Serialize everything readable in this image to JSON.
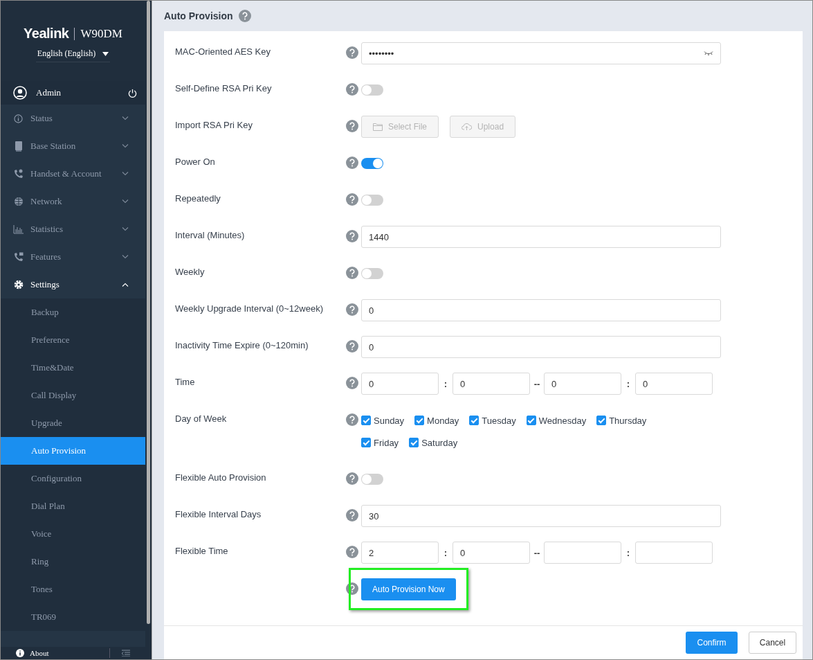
{
  "sidebar": {
    "logo": "Yealink",
    "model": "W90DM",
    "language": "English (English)",
    "user": "Admin",
    "menu": [
      {
        "label": "Status",
        "expanded": false
      },
      {
        "label": "Base Station",
        "expanded": false
      },
      {
        "label": "Handset & Account",
        "expanded": false
      },
      {
        "label": "Network",
        "expanded": false
      },
      {
        "label": "Statistics",
        "expanded": false
      },
      {
        "label": "Features",
        "expanded": false
      },
      {
        "label": "Settings",
        "expanded": true,
        "children": [
          {
            "label": "Backup",
            "selected": false
          },
          {
            "label": "Preference",
            "selected": false
          },
          {
            "label": "Time&Date",
            "selected": false
          },
          {
            "label": "Call Display",
            "selected": false
          },
          {
            "label": "Upgrade",
            "selected": false
          },
          {
            "label": "Auto Provision",
            "selected": true
          },
          {
            "label": "Configuration",
            "selected": false
          },
          {
            "label": "Dial Plan",
            "selected": false
          },
          {
            "label": "Voice",
            "selected": false
          },
          {
            "label": "Ring",
            "selected": false
          },
          {
            "label": "Tones",
            "selected": false
          },
          {
            "label": "TR069",
            "selected": false
          }
        ]
      }
    ],
    "footer": {
      "about": "About"
    }
  },
  "page": {
    "title": "Auto Provision"
  },
  "form": [
    {
      "kind": "password",
      "label": "MAC-Oriented AES Key",
      "value": "••••••••"
    },
    {
      "kind": "toggle",
      "label": "Self-Define RSA Pri Key",
      "on": false
    },
    {
      "kind": "files",
      "label": "Import RSA Pri Key",
      "buttons": [
        "Select File",
        "Upload"
      ]
    },
    {
      "kind": "toggle",
      "label": "Power On",
      "on": true
    },
    {
      "kind": "toggle",
      "label": "Repeatedly",
      "on": false
    },
    {
      "kind": "text",
      "label": "Interval (Minutes)",
      "value": "1440"
    },
    {
      "kind": "toggle",
      "label": "Weekly",
      "on": false
    },
    {
      "kind": "text",
      "label": "Weekly Upgrade Interval (0~12week)",
      "value": "0"
    },
    {
      "kind": "text",
      "label": "Inactivity Time Expire (0~120min)",
      "value": "0"
    },
    {
      "kind": "time",
      "label": "Time",
      "fields": [
        "0",
        "0",
        "0",
        "0"
      ],
      "separators": [
        ":",
        "--",
        ":"
      ]
    },
    {
      "kind": "days",
      "label": "Day of Week",
      "days": [
        {
          "label": "Sunday",
          "checked": true
        },
        {
          "label": "Monday",
          "checked": true
        },
        {
          "label": "Tuesday",
          "checked": true
        },
        {
          "label": "Wednesday",
          "checked": true
        },
        {
          "label": "Thursday",
          "checked": true
        },
        {
          "label": "Friday",
          "checked": true
        },
        {
          "label": "Saturday",
          "checked": true
        }
      ]
    },
    {
      "kind": "toggle",
      "label": "Flexible Auto Provision",
      "on": false
    },
    {
      "kind": "text",
      "label": "Flexible Interval Days",
      "value": "30"
    },
    {
      "kind": "time",
      "label": "Flexible Time",
      "fields": [
        "2",
        "0"
      ],
      "separators": [
        ":",
        "--",
        ":"
      ]
    },
    {
      "kind": "action",
      "button": "Auto Provision Now",
      "highlighted": true
    }
  ],
  "footer_buttons": [
    "Confirm",
    "Cancel"
  ]
}
